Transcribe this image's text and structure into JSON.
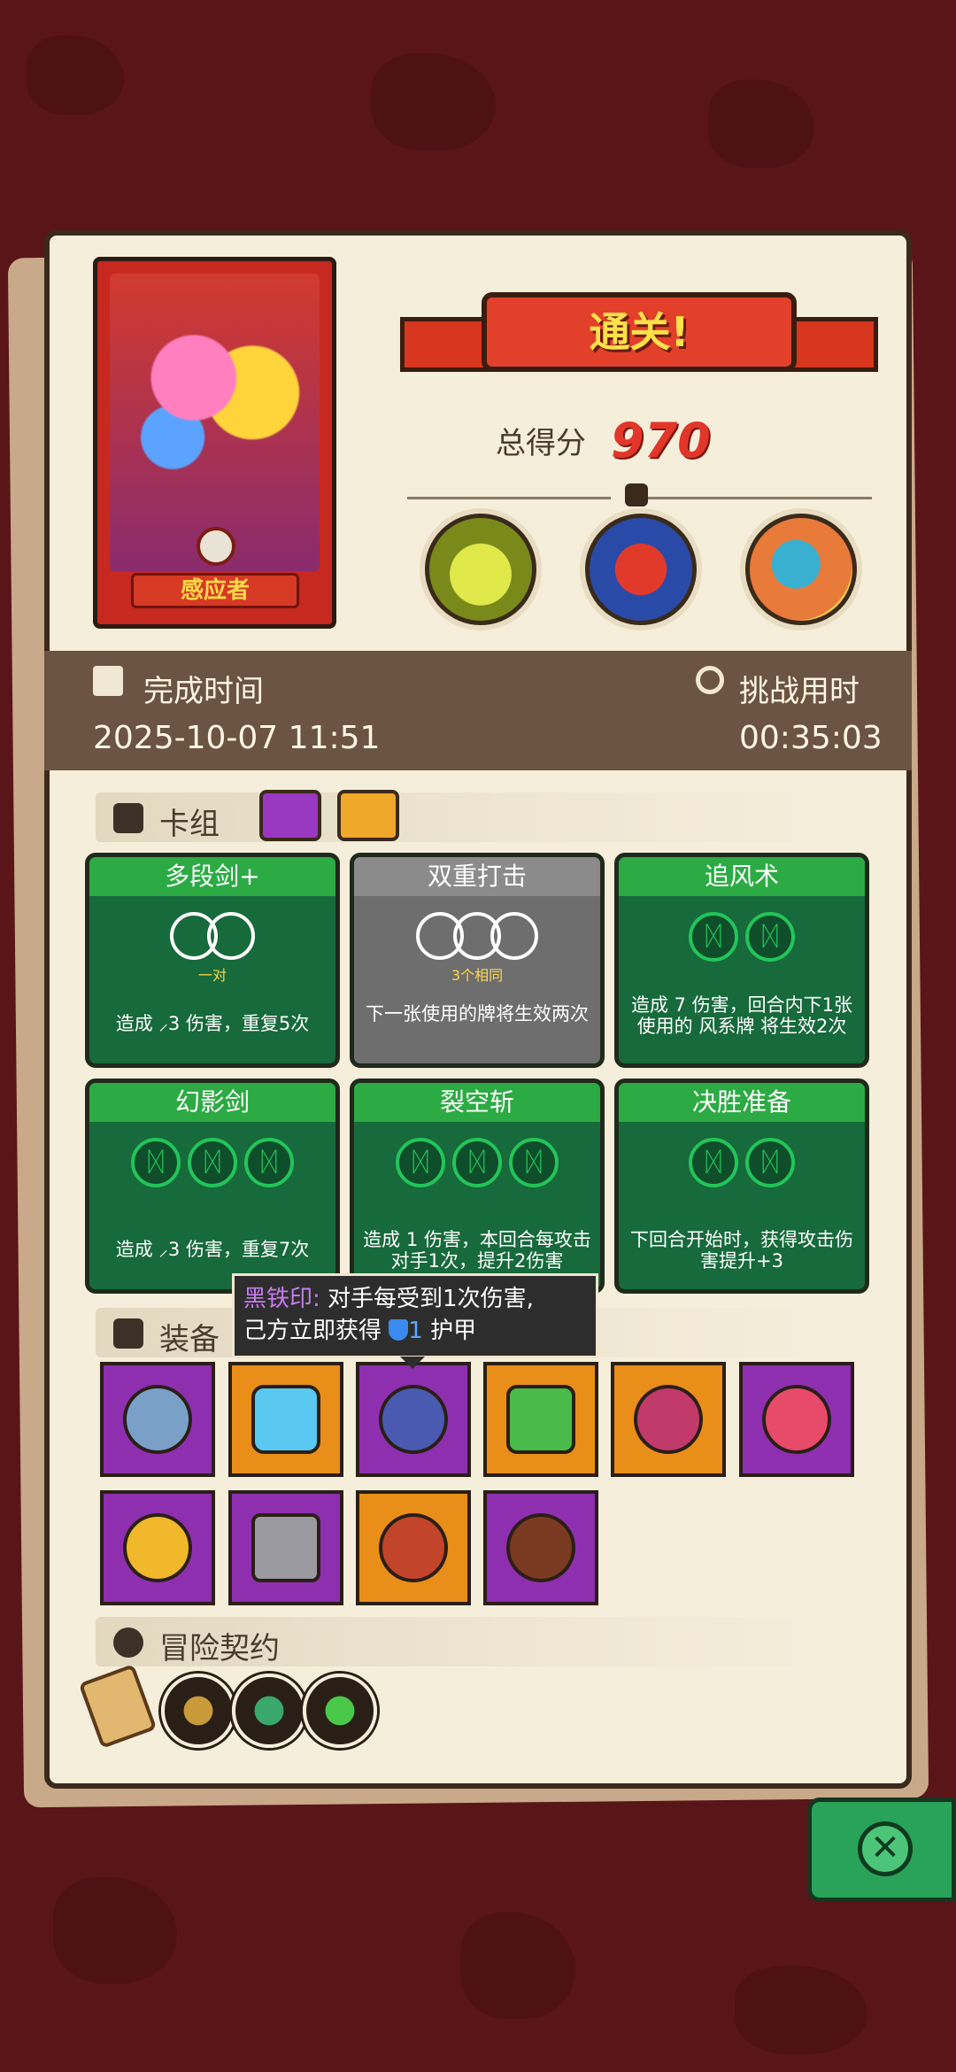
{
  "hero": {
    "name": "感应者"
  },
  "banner": {
    "title": "通关!"
  },
  "score": {
    "label": "总得分",
    "value": "970"
  },
  "bosses": [
    {
      "name": "skeleton-dino-boss"
    },
    {
      "name": "cage-monster-boss"
    },
    {
      "name": "fish-dragon-boss"
    }
  ],
  "info": {
    "finish_label": "完成时间",
    "finish_value": "2025-10-07 11:51",
    "duration_label": "挑战用时",
    "duration_value": "00:35:03"
  },
  "deck": {
    "title": "卡组",
    "cards": [
      {
        "name": "多段剑+",
        "note": "一对",
        "desc": "造成 ⸝3 伤害，重复5次",
        "style": "green",
        "rings": "pair"
      },
      {
        "name": "双重打击",
        "note": "3个相同",
        "desc": "下一张使用的牌将生效两次",
        "style": "gray",
        "rings": "triple"
      },
      {
        "name": "追风术",
        "note": "",
        "desc": "造成 7 伤害，回合内下1张使用的 风系牌 将生效2次",
        "style": "green",
        "rings": "wind2"
      },
      {
        "name": "幻影剑",
        "note": "",
        "desc": "造成 ⸝3 伤害，重复7次",
        "style": "green",
        "rings": "wind3"
      },
      {
        "name": "裂空斩",
        "note": "",
        "desc": "造成 1 伤害，本回合每攻击对手1次，提升2伤害",
        "style": "green",
        "rings": "wind3"
      },
      {
        "name": "决胜准备",
        "note": "",
        "desc": "下回合开始时，获得攻击伤害提升+3",
        "style": "green",
        "rings": "wind2"
      }
    ]
  },
  "equipment": {
    "title": "装备",
    "tooltip": {
      "name": "黑铁印:",
      "line1": "对手每受到1次伤害,",
      "line2a": "己方立即获得",
      "line2b": "1",
      "line2c": "护甲"
    },
    "items": [
      {
        "name": "diamond-ring-icon",
        "color": "purple"
      },
      {
        "name": "ice-shield-icon",
        "color": "orange"
      },
      {
        "name": "black-iron-seal-icon",
        "color": "purple"
      },
      {
        "name": "green-slab-icon",
        "color": "orange"
      },
      {
        "name": "thorn-heart-icon",
        "color": "orange"
      },
      {
        "name": "spotted-mushroom-icon",
        "color": "purple"
      },
      {
        "name": "gold-ring-icon",
        "color": "purple"
      },
      {
        "name": "stone-cube-icon",
        "color": "purple"
      },
      {
        "name": "fire-disc-icon",
        "color": "orange"
      },
      {
        "name": "wood-button-icon",
        "color": "purple"
      }
    ]
  },
  "contract": {
    "title": "冒险契约",
    "items": [
      "scroll-icon",
      "tag-icon",
      "bracelet-icon",
      "potion-icon"
    ]
  },
  "colors": {
    "panel": "#f5eedb",
    "bg": "#5a1518",
    "accent": "#e2362a",
    "card_green": "#176a3b"
  }
}
